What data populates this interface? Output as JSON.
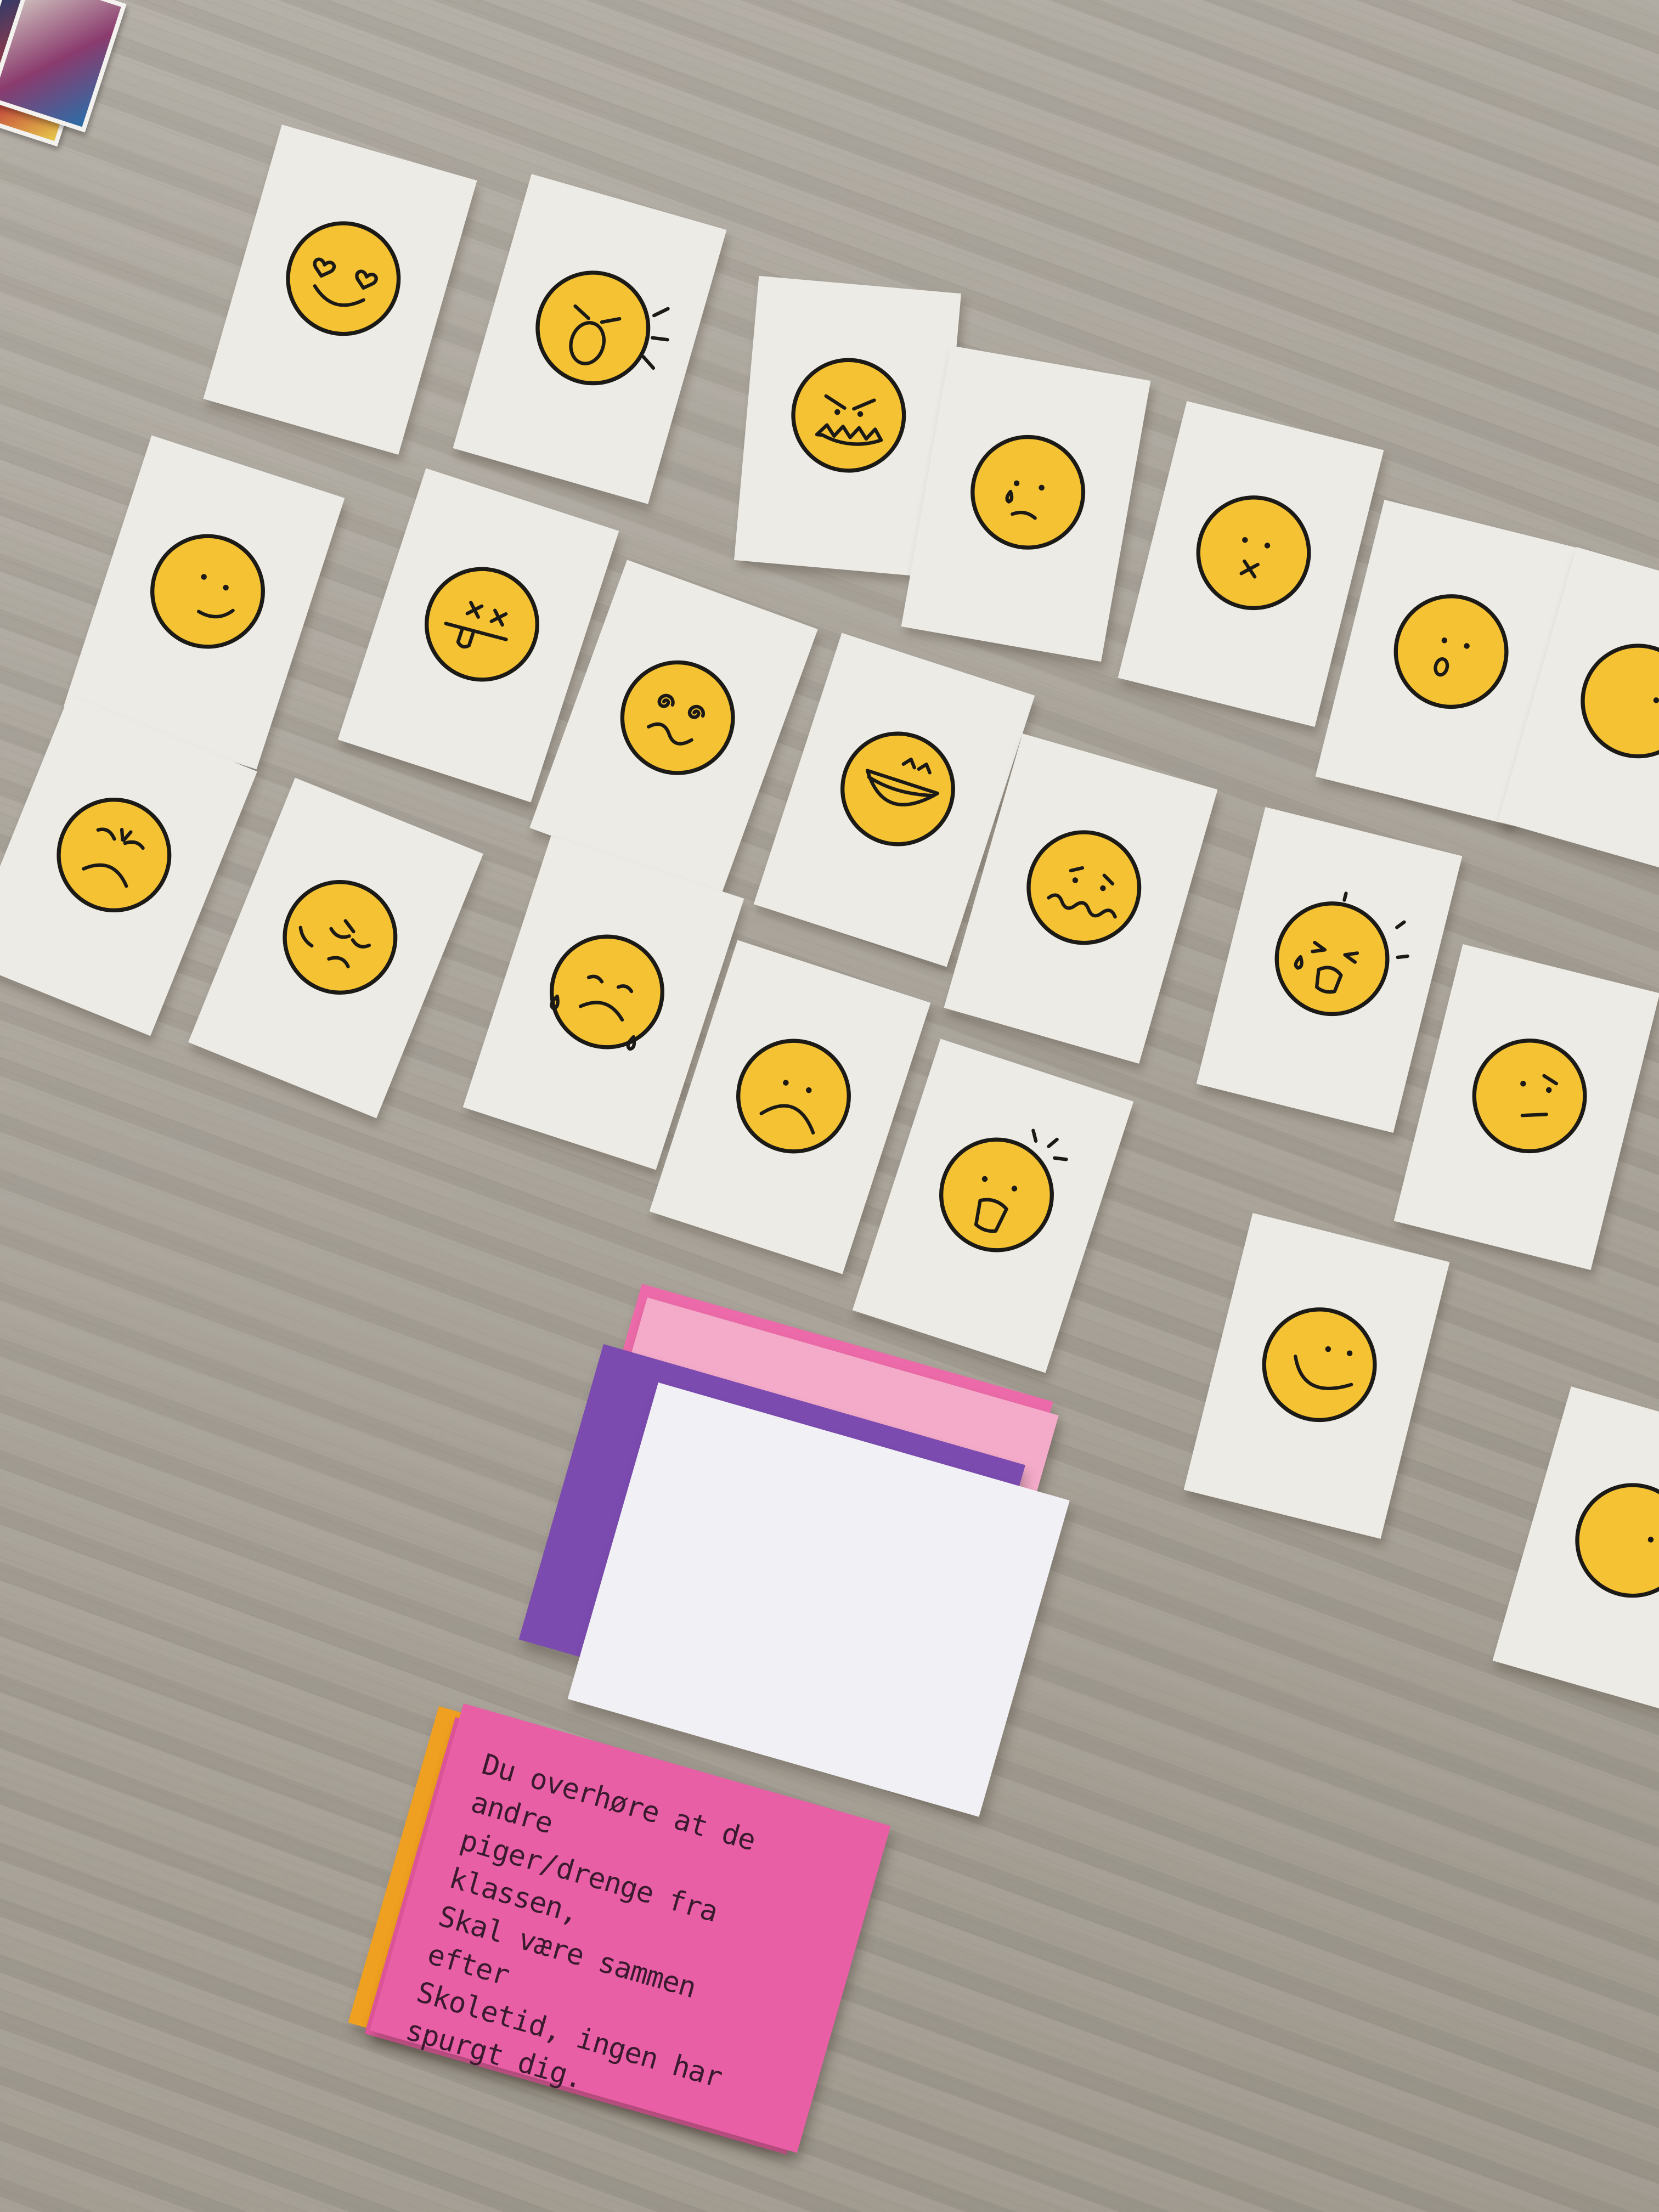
{
  "scene": "emotion-cards-on-floor",
  "colors": {
    "floor": "#a8a298",
    "card": "#ecebe6",
    "face": "#f4c233",
    "ink": "#1c1a16",
    "pink_card": "#e85fa6",
    "light_pink_card": "#f4a9c9",
    "purple_card": "#7b4bb0",
    "orange_card": "#f0a020"
  },
  "cards": [
    {
      "id": "love",
      "expression": "heart-eyes"
    },
    {
      "id": "yelling",
      "expression": "screaming"
    },
    {
      "id": "angry",
      "expression": "angry-teeth"
    },
    {
      "id": "sad-tear",
      "expression": "sad-single-tear"
    },
    {
      "id": "hurt",
      "expression": "mouth-x"
    },
    {
      "id": "surprised",
      "expression": "small-o"
    },
    {
      "id": "smirk",
      "expression": "smirk"
    },
    {
      "id": "dead",
      "expression": "x-eyes-tongue"
    },
    {
      "id": "dizzy",
      "expression": "spiral-eyes"
    },
    {
      "id": "laughing",
      "expression": "laughing"
    },
    {
      "id": "grumpy",
      "expression": "grumpy"
    },
    {
      "id": "tired",
      "expression": "tired"
    },
    {
      "id": "crying",
      "expression": "crying"
    },
    {
      "id": "nervous",
      "expression": "wavy-mouth"
    },
    {
      "id": "scared",
      "expression": "scared-squint"
    },
    {
      "id": "frown",
      "expression": "frown"
    },
    {
      "id": "shocked",
      "expression": "shocked"
    },
    {
      "id": "skeptical",
      "expression": "skeptical"
    },
    {
      "id": "happy",
      "expression": "big-smile"
    },
    {
      "id": "edge-top",
      "expression": "partial"
    },
    {
      "id": "edge-bottom",
      "expression": "partial"
    }
  ],
  "situation_card": {
    "text": "Du overhøre at de andre\npiger/drenge fra klassen,\nSkal være sammen efter\nSkoletid, ingen har\nspurgt dig."
  }
}
